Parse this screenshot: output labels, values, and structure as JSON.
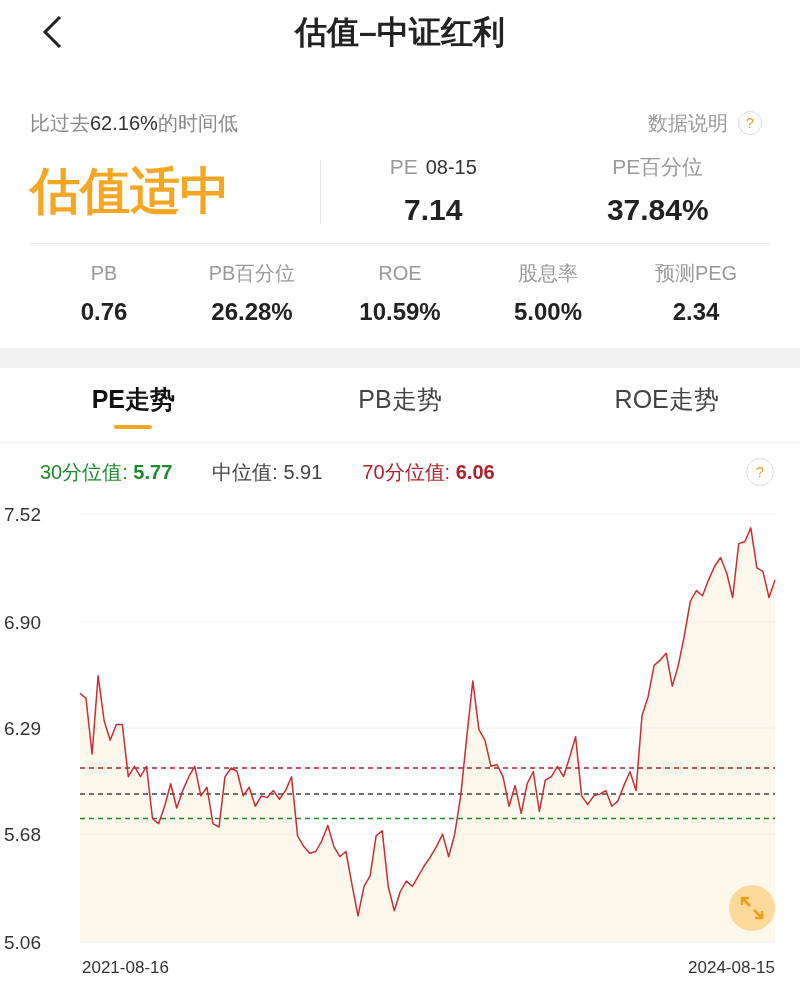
{
  "header": {
    "title": "估值–中证红利"
  },
  "summary": {
    "note": "比过去**62.16%**的时间低",
    "help_label": "数据说明",
    "help_icon": "?",
    "verdict": "估值适中",
    "main_metrics": [
      {
        "label": "PE",
        "date": "08-15",
        "value": "7.14"
      },
      {
        "label": "PE百分位",
        "value": "37.84%"
      }
    ],
    "metrics": [
      {
        "label": "PB",
        "value": "0.76"
      },
      {
        "label": "PB百分位",
        "value": "26.28%"
      },
      {
        "label": "ROE",
        "value": "10.59%"
      },
      {
        "label": "股息率",
        "value": "5.00%"
      },
      {
        "label": "预测PEG",
        "value": "2.34"
      }
    ]
  },
  "tabs": [
    {
      "label": "PE走势",
      "selected": true
    },
    {
      "label": "PB走势",
      "selected": false
    },
    {
      "label": "ROE走势",
      "selected": false
    }
  ],
  "legend": {
    "items": [
      {
        "label": "30分位值: ",
        "value": "5.77",
        "color": "#1e8a2e"
      },
      {
        "label": "中位值: ",
        "value": "5.91",
        "color": "#444444"
      },
      {
        "label": "70分位值: ",
        "value": "6.06",
        "color": "#b0202a"
      }
    ],
    "help_icon": "?"
  },
  "chart_data": {
    "type": "area",
    "ylim": [
      5.06,
      7.52
    ],
    "yticks": [
      {
        "value": 5.06,
        "label": "5.06"
      },
      {
        "value": 5.68,
        "label": "5.68"
      },
      {
        "value": 6.29,
        "label": "6.29"
      },
      {
        "value": 6.9,
        "label": "6.90"
      },
      {
        "value": 7.52,
        "label": "7.52"
      }
    ],
    "grid": true,
    "series": [
      {
        "color": "#c62f35",
        "values": [
          6.49,
          6.46,
          6.14,
          6.59,
          6.33,
          6.22,
          6.31,
          6.31,
          6.01,
          6.07,
          6.01,
          6.07,
          5.77,
          5.74,
          5.84,
          5.97,
          5.83,
          5.93,
          6.01,
          6.07,
          5.9,
          5.95,
          5.74,
          5.72,
          6.01,
          6.06,
          6.04,
          5.9,
          5.95,
          5.84,
          5.9,
          5.89,
          5.93,
          5.88,
          5.93,
          6.01,
          5.67,
          5.61,
          5.57,
          5.58,
          5.64,
          5.73,
          5.61,
          5.55,
          5.58,
          5.39,
          5.21,
          5.38,
          5.44,
          5.67,
          5.7,
          5.38,
          5.24,
          5.35,
          5.41,
          5.38,
          5.44,
          5.5,
          5.55,
          5.61,
          5.68,
          5.55,
          5.68,
          5.9,
          6.24,
          6.56,
          6.28,
          6.22,
          6.07,
          6.08,
          6.01,
          5.84,
          5.96,
          5.8,
          5.97,
          6.04,
          5.81,
          5.99,
          6.01,
          6.07,
          6.01,
          6.12,
          6.24,
          5.9,
          5.85,
          5.9,
          5.91,
          5.93,
          5.84,
          5.87,
          5.96,
          6.04,
          5.93,
          6.36,
          6.47,
          6.65,
          6.68,
          6.72,
          6.53,
          6.65,
          6.82,
          7.02,
          7.08,
          7.05,
          7.14,
          7.22,
          7.27,
          7.18,
          7.04,
          7.35,
          7.36,
          7.44,
          7.21,
          7.19,
          7.04,
          7.14
        ]
      }
    ],
    "ref_lines": [
      {
        "value": 5.77,
        "color": "#1e8a2e",
        "axis": "y"
      },
      {
        "value": 5.91,
        "color": "#444444",
        "axis": "y"
      },
      {
        "value": 6.06,
        "color": "#b0202a",
        "axis": "y"
      }
    ]
  },
  "date_range": {
    "start": "2021-08-16",
    "end": "2024-08-15"
  }
}
